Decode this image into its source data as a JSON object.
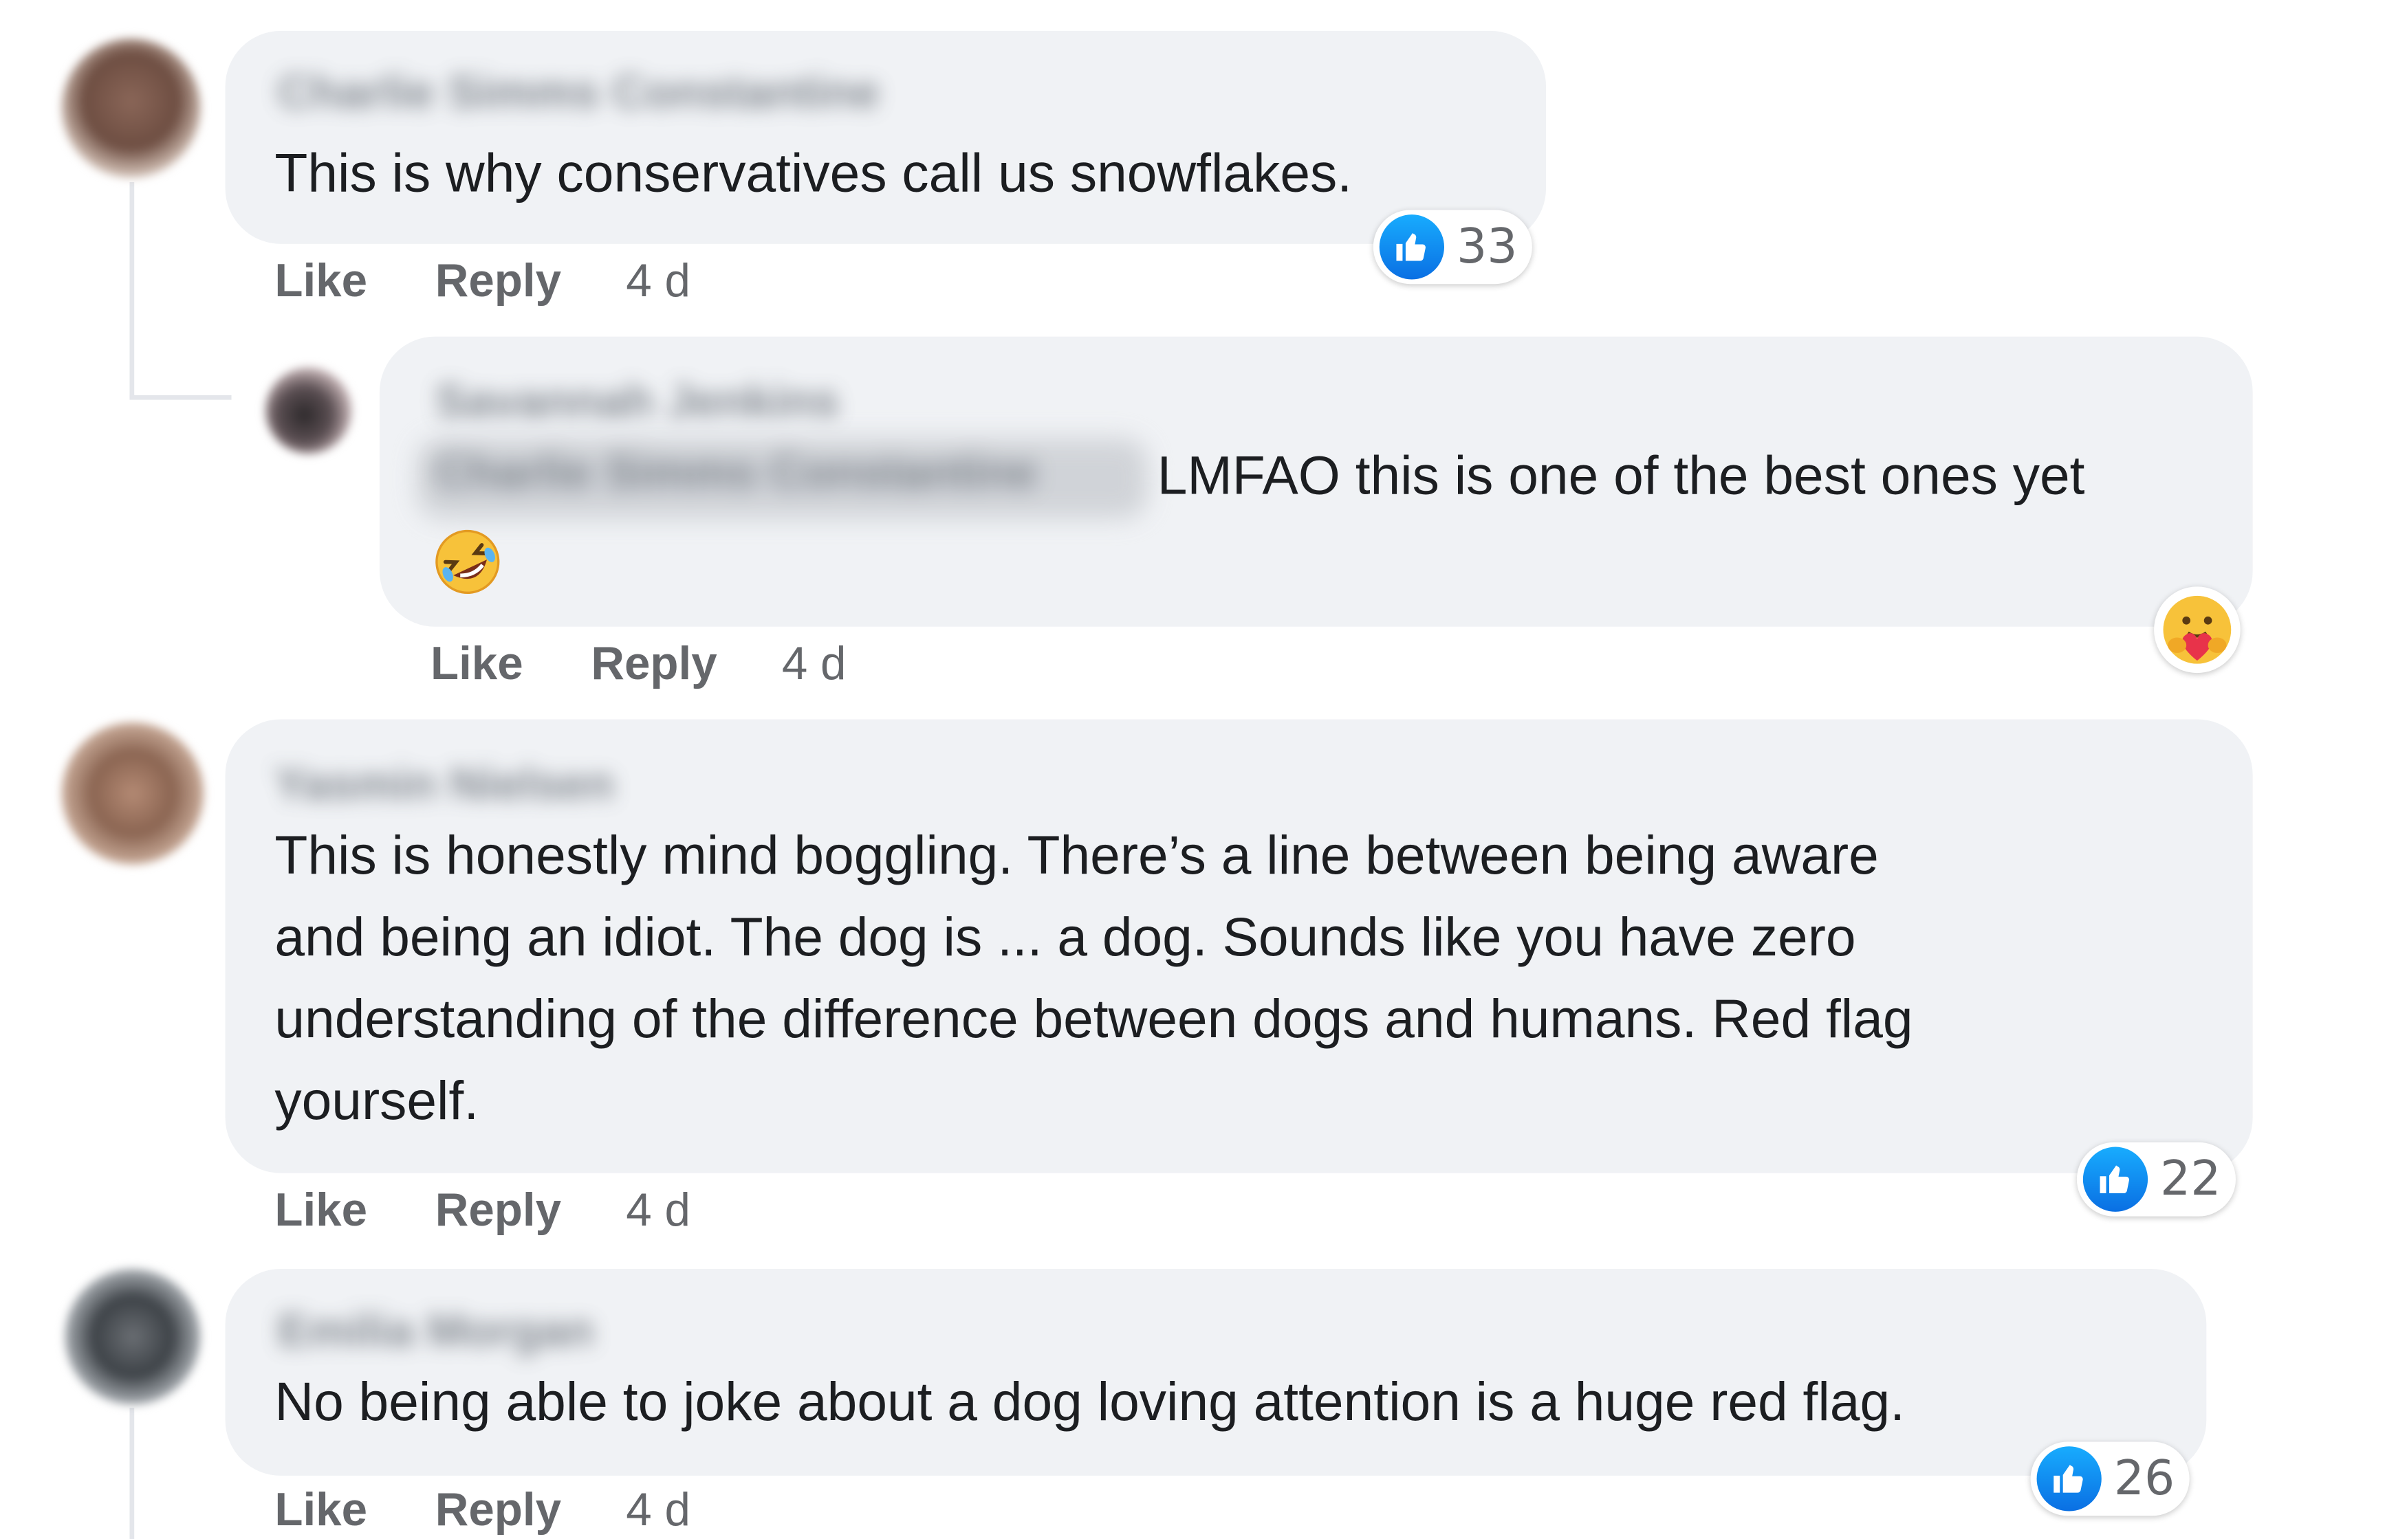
{
  "comments": [
    {
      "author": "Charlie Simms Constantine",
      "text": "This is why conservatives call us snowflakes.",
      "actions": {
        "like": "Like",
        "reply": "Reply",
        "time": "4 d"
      },
      "reaction": {
        "icon": "thumbs-up-icon",
        "count": "33"
      }
    },
    {
      "author": "Savannah Jenkins",
      "mention": "Charlie Simms Constantine",
      "text": "LMFAO this is one of the best ones yet",
      "emoji": "rolling-on-floor-laughing-emoji",
      "actions": {
        "like": "Like",
        "reply": "Reply",
        "time": "4 d"
      },
      "reaction": {
        "icon": "care-reaction-icon"
      }
    },
    {
      "author": "Yasmin Nielsen",
      "text": "This is honestly mind boggling. There’s a line between being aware\nand being an idiot. The dog is ... a dog. Sounds like you have zero\nunderstanding of the difference between dogs and humans. Red flag\nyourself.",
      "actions": {
        "like": "Like",
        "reply": "Reply",
        "time": "4 d"
      },
      "reaction": {
        "icon": "thumbs-up-icon",
        "count": "22"
      }
    },
    {
      "author": "Emilia Morgan",
      "text": "No being able to joke about a dog loving attention is a huge red flag.",
      "actions": {
        "like": "Like",
        "reply": "Reply",
        "time": "4 d"
      },
      "reaction": {
        "icon": "thumbs-up-icon",
        "count": "26"
      }
    }
  ],
  "colors": {
    "bubble": "#f0f2f5",
    "text": "#1c1e21",
    "secondary_text": "#65676b",
    "like_blue": "#0a6fe3"
  }
}
